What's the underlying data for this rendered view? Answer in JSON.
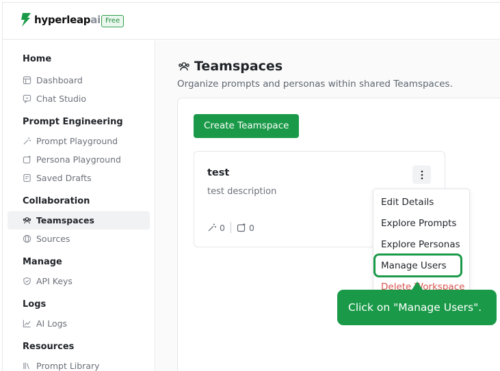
{
  "brand": {
    "name_main": "hyperleap",
    "name_suffix": "ai",
    "plan_badge": "Free",
    "accent": "#1a9a48"
  },
  "sidebar": {
    "sections": [
      {
        "title": "Home",
        "items": [
          {
            "label": "Dashboard",
            "icon": "dashboard-icon"
          },
          {
            "label": "Chat Studio",
            "icon": "chat-icon"
          }
        ]
      },
      {
        "title": "Prompt Engineering",
        "items": [
          {
            "label": "Prompt Playground",
            "icon": "magic-wand-icon"
          },
          {
            "label": "Persona Playground",
            "icon": "persona-icon"
          },
          {
            "label": "Saved Drafts",
            "icon": "drafts-icon"
          }
        ]
      },
      {
        "title": "Collaboration",
        "items": [
          {
            "label": "Teamspaces",
            "icon": "users-icon",
            "active": true
          },
          {
            "label": "Sources",
            "icon": "globe-icon"
          }
        ]
      },
      {
        "title": "Manage",
        "items": [
          {
            "label": "API Keys",
            "icon": "shield-icon"
          }
        ]
      },
      {
        "title": "Logs",
        "items": [
          {
            "label": "AI Logs",
            "icon": "chart-icon"
          }
        ]
      },
      {
        "title": "Resources",
        "items": [
          {
            "label": "Prompt Library",
            "icon": "library-icon"
          }
        ]
      }
    ]
  },
  "page": {
    "title": "Teamspaces",
    "subtitle": "Organize prompts and personas within shared Teamspaces.",
    "create_button": "Create Teamspace"
  },
  "card": {
    "title": "test",
    "description": "test description",
    "prompt_count": "0",
    "persona_count": "0"
  },
  "menu": {
    "items": [
      "Edit Details",
      "Explore Prompts",
      "Explore Personas",
      "Manage Users",
      "Delete Workspace"
    ],
    "highlighted": "Manage Users"
  },
  "tooltip": {
    "text": "Click on \"Manage Users\"."
  }
}
